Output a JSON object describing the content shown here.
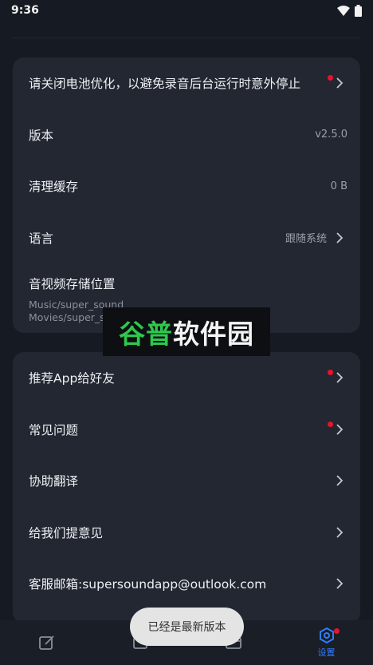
{
  "status_bar": {
    "time": "9:36"
  },
  "settings_card_1": {
    "battery_notice": "请关闭电池优化，以避免录音后台运行时意外停止",
    "version_label": "版本",
    "version_value": "v2.5.0",
    "cache_label": "清理缓存",
    "cache_value": "0 B",
    "language_label": "语言",
    "language_value": "跟随系统",
    "storage_label": "音视频存储位置",
    "storage_path_1": "Music/super_sound",
    "storage_path_2": "Movies/super_sound"
  },
  "settings_card_2": {
    "recommend_label": "推荐App给好友",
    "faq_label": "常见问题",
    "translate_label": "协助翻译",
    "feedback_label": "给我们提意见",
    "email_label": "客服邮箱:supersoundapp@outlook.com"
  },
  "watermark": {
    "part1": "谷普",
    "part2": "软件园"
  },
  "bottom_nav": {
    "settings_label": "设置"
  },
  "toast": {
    "text": "已经是最新版本"
  },
  "colors": {
    "background": "#161a22",
    "card": "#222731",
    "accent": "#2d7dff",
    "notification_dot": "#e8142b"
  }
}
